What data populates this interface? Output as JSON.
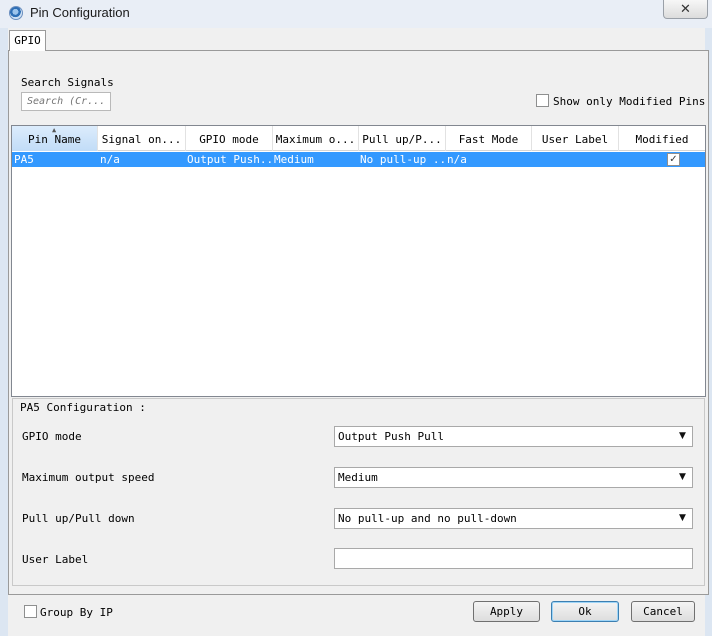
{
  "window": {
    "title": "Pin Configuration",
    "close_glyph": "✕",
    "icon": "app-gear-icon"
  },
  "tabs": [
    {
      "label": "GPIO",
      "active": true
    }
  ],
  "search": {
    "label": "Search Signals",
    "placeholder": "Search (Cr..."
  },
  "show_only_modified": {
    "label": "Show only Modified Pins",
    "checked": false
  },
  "table": {
    "columns": [
      "Pin Name",
      "Signal on...",
      "GPIO mode",
      "Maximum o...",
      "Pull up/P...",
      "Fast Mode",
      "User Label",
      "Modified"
    ],
    "sorted_column": "Pin Name",
    "rows": [
      {
        "pin_name": "PA5",
        "signal_on": "n/a",
        "gpio_mode": "Output Push...",
        "max_output": "Medium",
        "pull": "No pull-up ...",
        "fast_mode": "n/a",
        "user_label": "",
        "modified": true,
        "selected": true
      }
    ]
  },
  "config": {
    "title": "PA5 Configuration :",
    "gpio_mode": {
      "label": "GPIO mode",
      "value": "Output Push Pull"
    },
    "max_speed": {
      "label": "Maximum output speed",
      "value": "Medium"
    },
    "pull": {
      "label": "Pull up/Pull down",
      "value": "No pull-up and no pull-down"
    },
    "user_label": {
      "label": "User Label",
      "value": ""
    }
  },
  "group_by_ip": {
    "label": "Group By IP",
    "checked": false
  },
  "buttons": {
    "apply": "Apply",
    "ok": "Ok",
    "cancel": "Cancel"
  },
  "colors": {
    "selection": "#3399ff",
    "titlebar": "#e9eef6",
    "dialog_bg": "#f0f0f0"
  }
}
